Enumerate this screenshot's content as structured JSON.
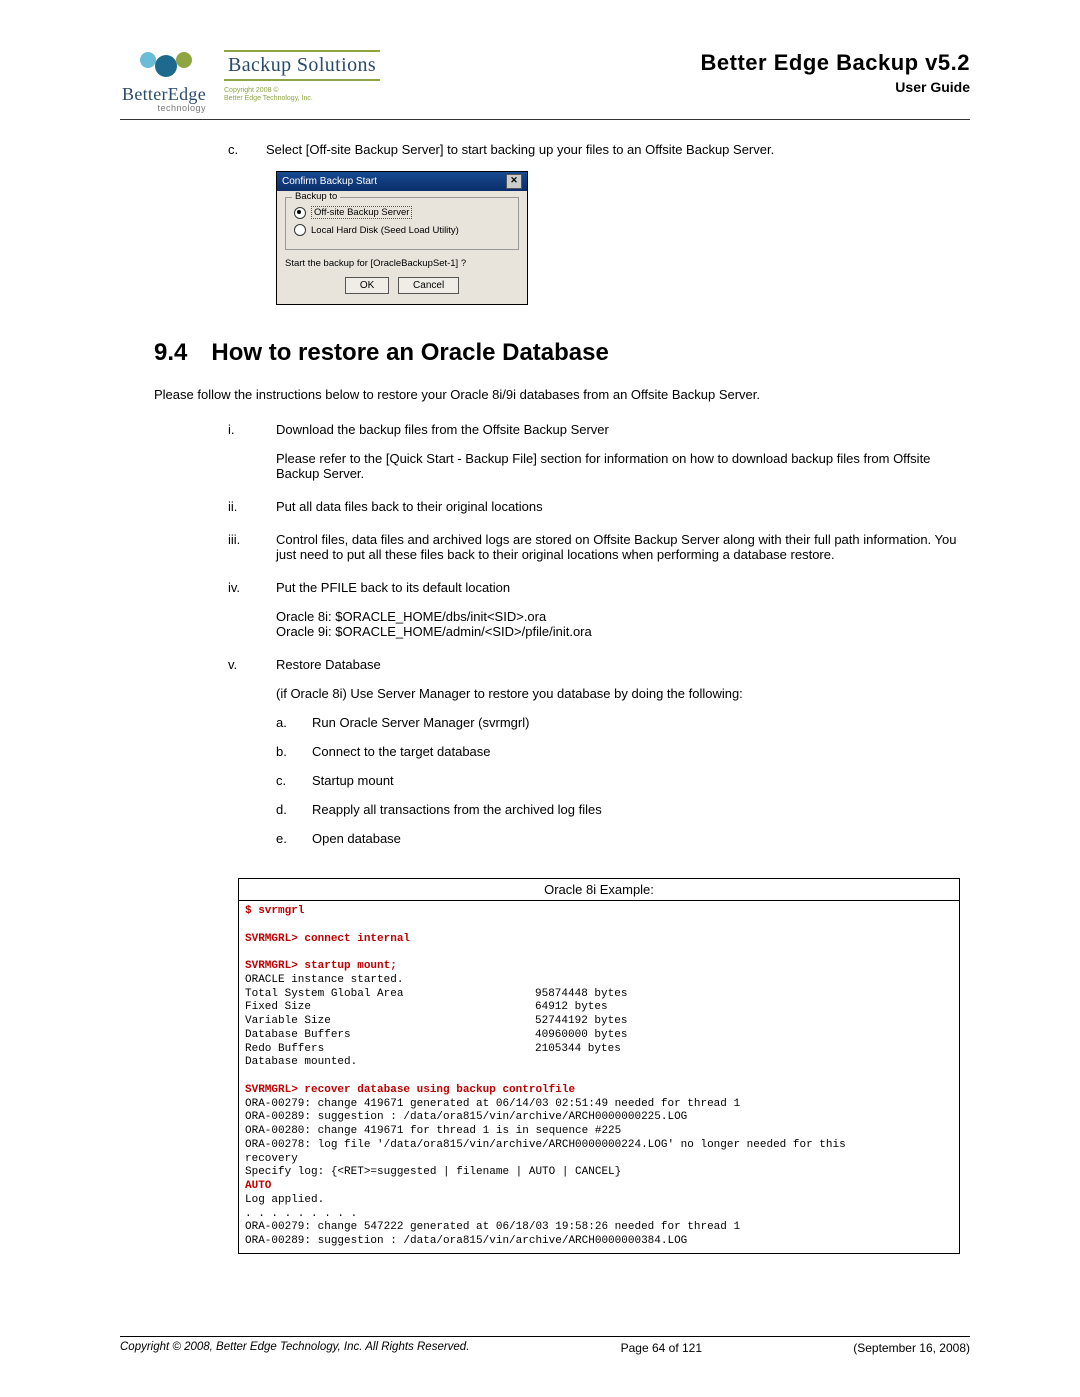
{
  "header": {
    "logo_brand_top": "BetterEdge",
    "logo_brand_sub": "technology",
    "logo_right": "Backup Solutions",
    "logo_sub1": "Copyright 2008 ©",
    "logo_sub2": "Better Edge Technology, Inc.",
    "title": "Better  Edge  Backup  v5.2",
    "subtitle": "User Guide"
  },
  "step_c": {
    "marker": "c.",
    "text": "Select [Off-site Backup Server] to start backing up your files to an Offsite Backup Server."
  },
  "dialog": {
    "title": "Confirm Backup Start",
    "legend": "Backup to",
    "opt1": "Off-site Backup Server",
    "opt2": "Local Hard Disk (Seed Load Utility)",
    "question": "Start the backup for [OracleBackupSet-1] ?",
    "ok": "OK",
    "cancel": "Cancel"
  },
  "section": {
    "num": "9.4",
    "title": "How to restore an Oracle Database",
    "intro": "Please follow the instructions below to restore your Oracle 8i/9i databases from an Offsite Backup Server."
  },
  "steps": {
    "i": {
      "m": "i.",
      "t": "Download the backup files from the Offsite Backup Server",
      "p": "Please refer to the [Quick Start - Backup File] section for information on how to download backup files from Offsite Backup Server."
    },
    "ii": {
      "m": "ii.",
      "t": "Put all data files back to their original locations"
    },
    "iii": {
      "m": "iii.",
      "t": "Control files, data files and archived logs are stored on Offsite Backup Server along with their full path information. You just need to put all these files back to their original locations when performing a database restore."
    },
    "iv": {
      "m": "iv.",
      "t": "Put the PFILE back to its default location",
      "l1": "Oracle 8i: $ORACLE_HOME/dbs/init<SID>.ora",
      "l2": "Oracle 9i: $ORACLE_HOME/admin/<SID>/pfile/init.ora"
    },
    "v": {
      "m": "v.",
      "t": "Restore Database",
      "p": "(if Oracle 8i) Use Server Manager to restore you database by doing the following:",
      "a": {
        "m": "a.",
        "t": "Run Oracle Server Manager (svrmgrl)"
      },
      "b": {
        "m": "b.",
        "t": "Connect to the target database"
      },
      "c": {
        "m": "c.",
        "t": "Startup mount"
      },
      "d": {
        "m": "d.",
        "t": "Reapply all transactions from the archived log files"
      },
      "e": {
        "m": "e.",
        "t": "Open database"
      }
    }
  },
  "example": {
    "title": "Oracle 8i Example:",
    "l01": "$ svrmgrl",
    "l02": "SVRMGRL> connect internal",
    "l03": "SVRMGRL> startup mount;",
    "l04a": "ORACLE instance started.",
    "l05a": "Total System Global Area",
    "l05b": "95874448 bytes",
    "l06a": "Fixed Size",
    "l06b": "64912 bytes",
    "l07a": "Variable Size",
    "l07b": "52744192 bytes",
    "l08a": "Database Buffers",
    "l08b": "40960000 bytes",
    "l09a": "Redo Buffers",
    "l09b": "2105344 bytes",
    "l10": "Database mounted.",
    "l11": "SVRMGRL> recover database using backup controlfile",
    "l12": "ORA-00279: change 419671 generated at 06/14/03 02:51:49 needed for thread 1",
    "l13": "ORA-00289: suggestion : /data/ora815/vin/archive/ARCH0000000225.LOG",
    "l14": "ORA-00280: change 419671 for thread 1 is in sequence #225",
    "l15": "ORA-00278: log file '/data/ora815/vin/archive/ARCH0000000224.LOG' no longer needed for this",
    "l16": "recovery",
    "l17": "Specify log: {<RET>=suggested | filename | AUTO | CANCEL}",
    "l18": "AUTO",
    "l19": "Log applied.",
    "l20": ". . . . . . . . .",
    "l21": "ORA-00279: change 547222 generated at 06/18/03 19:58:26 needed for thread 1",
    "l22": "ORA-00289: suggestion : /data/ora815/vin/archive/ARCH0000000384.LOG"
  },
  "footer": {
    "copyright": "Copyright © 2008, Better Edge Technology, Inc.   All Rights Reserved.",
    "page": "Page 64 of 121",
    "date": "(September 16, 2008)"
  }
}
